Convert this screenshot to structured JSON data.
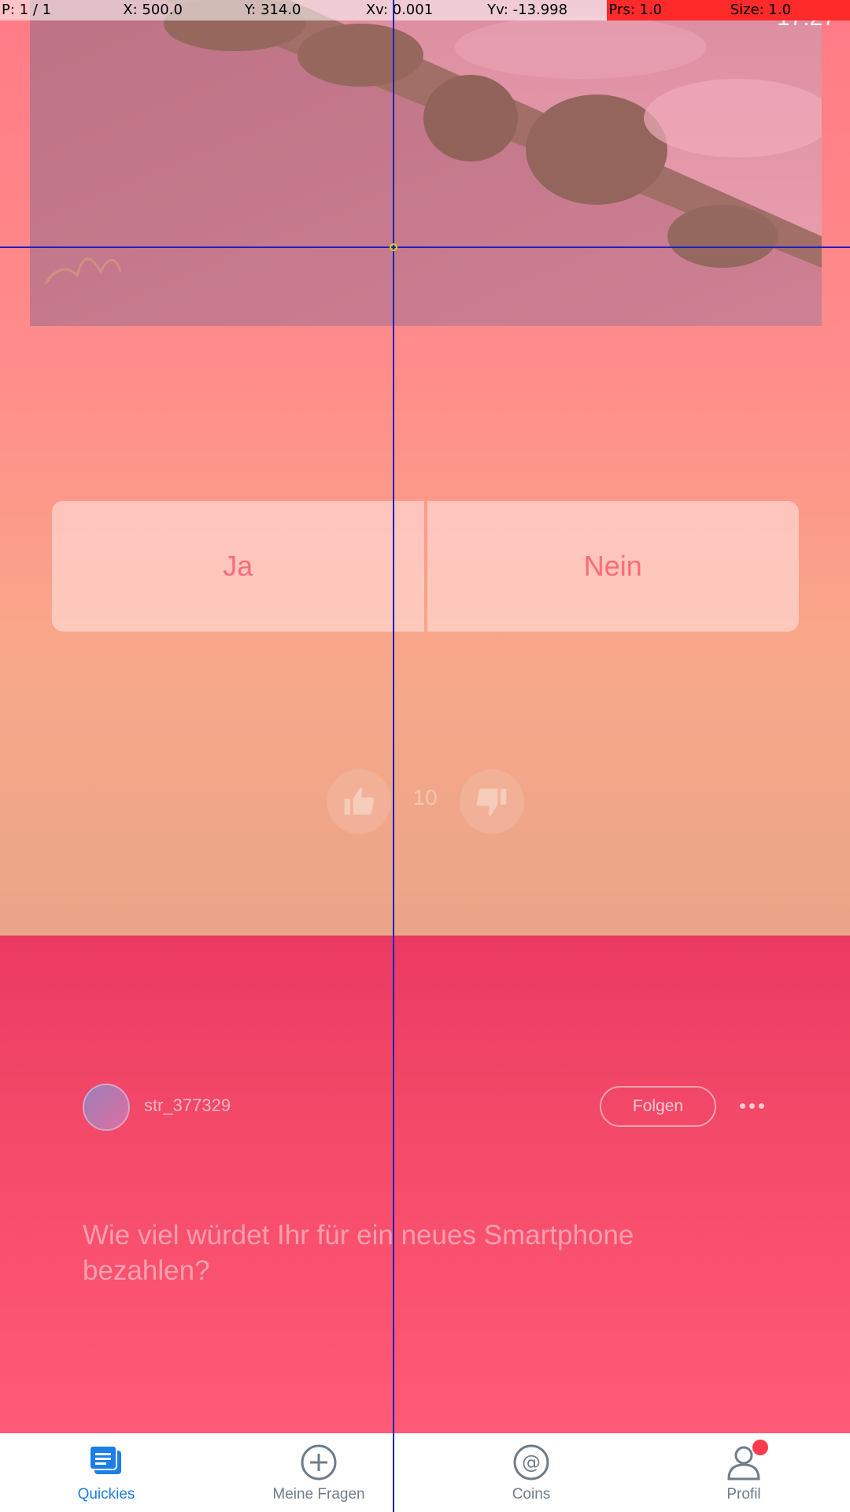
{
  "status_bar": {
    "time": "17:27"
  },
  "debug": {
    "pointer": "P: 1 / 1",
    "x": "X: 500.0",
    "y": "Y: 314.0",
    "xv": "Xv: 0.001",
    "yv": "Yv: -13.998",
    "prs": "Prs: 1.0",
    "size": "Size: 1.0"
  },
  "answers": {
    "yes": "Ja",
    "no": "Nein"
  },
  "votes": {
    "count": "10"
  },
  "post": {
    "username": "str_377329",
    "follow_label": "Folgen",
    "question": "Wie viel würdet Ihr für ein neues Smartphone bezahlen?"
  },
  "nav": {
    "items": [
      {
        "label": "Quickies",
        "icon": "quickies-icon",
        "active": true
      },
      {
        "label": "Meine Fragen",
        "icon": "plus-circle-icon",
        "active": false
      },
      {
        "label": "Coins",
        "icon": "at-coin-icon",
        "active": false
      },
      {
        "label": "Profil",
        "icon": "profile-icon",
        "active": false,
        "badge": true
      }
    ]
  },
  "colors": {
    "accent": "#1c7ee6",
    "panel": "#f44a69",
    "card_top": "#ff7b86",
    "badge": "#ff3b4e"
  }
}
